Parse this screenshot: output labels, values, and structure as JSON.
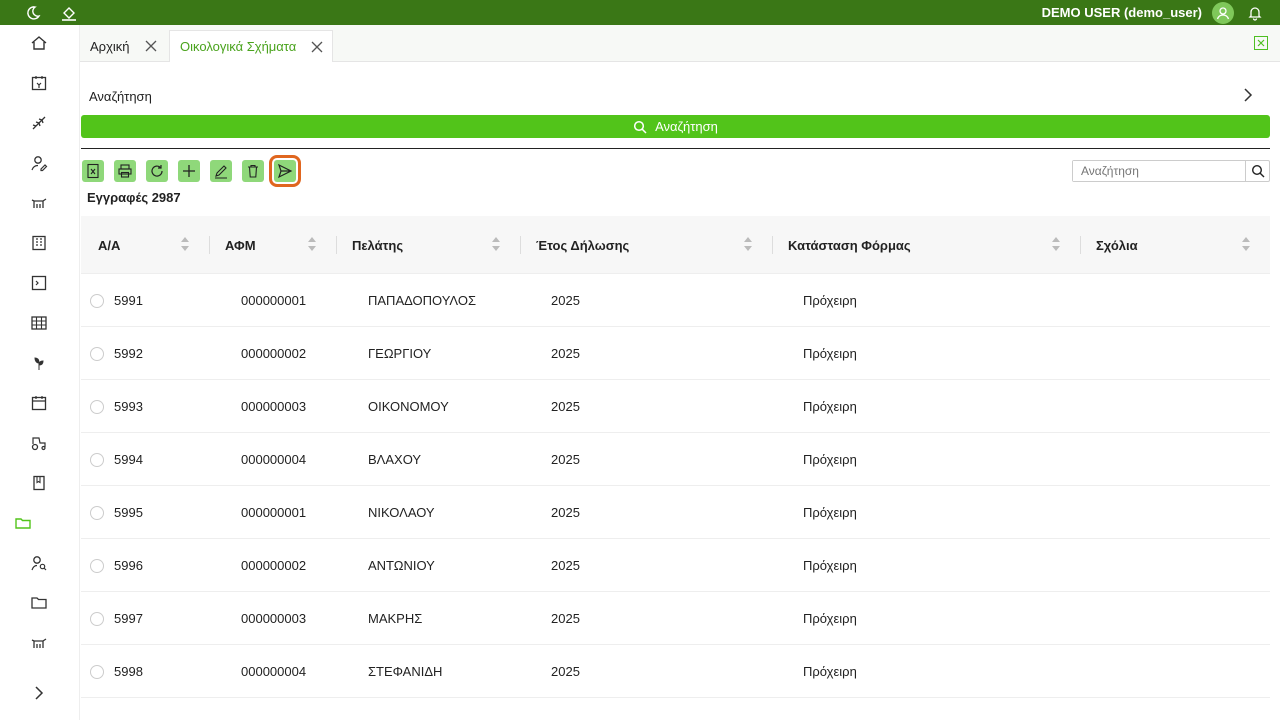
{
  "topbar": {
    "user_label": "DEMO USER (demo_user)",
    "icons": [
      "moon-icon",
      "paint-bucket-icon",
      "user-avatar-icon",
      "bell-icon"
    ]
  },
  "sidebar": {
    "items": [
      {
        "name": "home-icon"
      },
      {
        "name": "calendar-money-icon"
      },
      {
        "name": "wheat-icon"
      },
      {
        "name": "user-edit-icon"
      },
      {
        "name": "cow-icon"
      },
      {
        "name": "building-icon"
      },
      {
        "name": "terminal-icon"
      },
      {
        "name": "table-icon"
      },
      {
        "name": "plant-icon"
      },
      {
        "name": "calendar-icon"
      },
      {
        "name": "tractor-icon"
      },
      {
        "name": "book-icon"
      },
      {
        "name": "folder-open-icon"
      },
      {
        "name": "user-search-icon"
      },
      {
        "name": "folder-icon"
      },
      {
        "name": "cow-icon"
      },
      {
        "name": "chevron-right-icon"
      }
    ]
  },
  "tabs": [
    {
      "label": "Αρχική"
    },
    {
      "label": "Οικολογικά Σχήματα"
    }
  ],
  "search": {
    "panel_label": "Αναζήτηση",
    "button_label": "Αναζήτηση",
    "quick_placeholder": "Αναζήτηση"
  },
  "toolbar": [
    "excel-icon",
    "print-icon",
    "refresh-icon",
    "add-icon",
    "edit-icon",
    "delete-icon",
    "send-icon"
  ],
  "records_label": "Εγγραφές 2987",
  "table": {
    "columns": [
      "Α/Α",
      "ΑΦΜ",
      "Πελάτης",
      "Έτος Δήλωσης",
      "Κατάσταση Φόρμας",
      "Σχόλια"
    ],
    "rows": [
      {
        "aa": "5991",
        "afm": "000000001",
        "client": "ΠΑΠΑΔΟΠΟΥΛΟΣ",
        "year": "2025",
        "status": "Πρόχειρη",
        "comments": ""
      },
      {
        "aa": "5992",
        "afm": "000000002",
        "client": "ΓΕΩΡΓΙΟΥ",
        "year": "2025",
        "status": "Πρόχειρη",
        "comments": ""
      },
      {
        "aa": "5993",
        "afm": "000000003",
        "client": "ΟΙΚΟΝΟΜΟΥ",
        "year": "2025",
        "status": "Πρόχειρη",
        "comments": ""
      },
      {
        "aa": "5994",
        "afm": "000000004",
        "client": "ΒΛΑΧΟΥ",
        "year": "2025",
        "status": "Πρόχειρη",
        "comments": ""
      },
      {
        "aa": "5995",
        "afm": "000000001",
        "client": "ΝΙΚΟΛΑΟΥ",
        "year": "2025",
        "status": "Πρόχειρη",
        "comments": ""
      },
      {
        "aa": "5996",
        "afm": "000000002",
        "client": "ΑΝΤΩΝΙΟΥ",
        "year": "2025",
        "status": "Πρόχειρη",
        "comments": ""
      },
      {
        "aa": "5997",
        "afm": "000000003",
        "client": "ΜΑΚΡΗΣ",
        "year": "2025",
        "status": "Πρόχειρη",
        "comments": ""
      },
      {
        "aa": "5998",
        "afm": "000000004",
        "client": "ΣΤΕΦΑΝΙΔΗ",
        "year": "2025",
        "status": "Πρόχειρη",
        "comments": ""
      }
    ]
  },
  "colors": {
    "topbar": "#3a7716",
    "accent": "#52c41a",
    "tool_bg": "#8fd87a",
    "highlight": "#e0661f"
  }
}
